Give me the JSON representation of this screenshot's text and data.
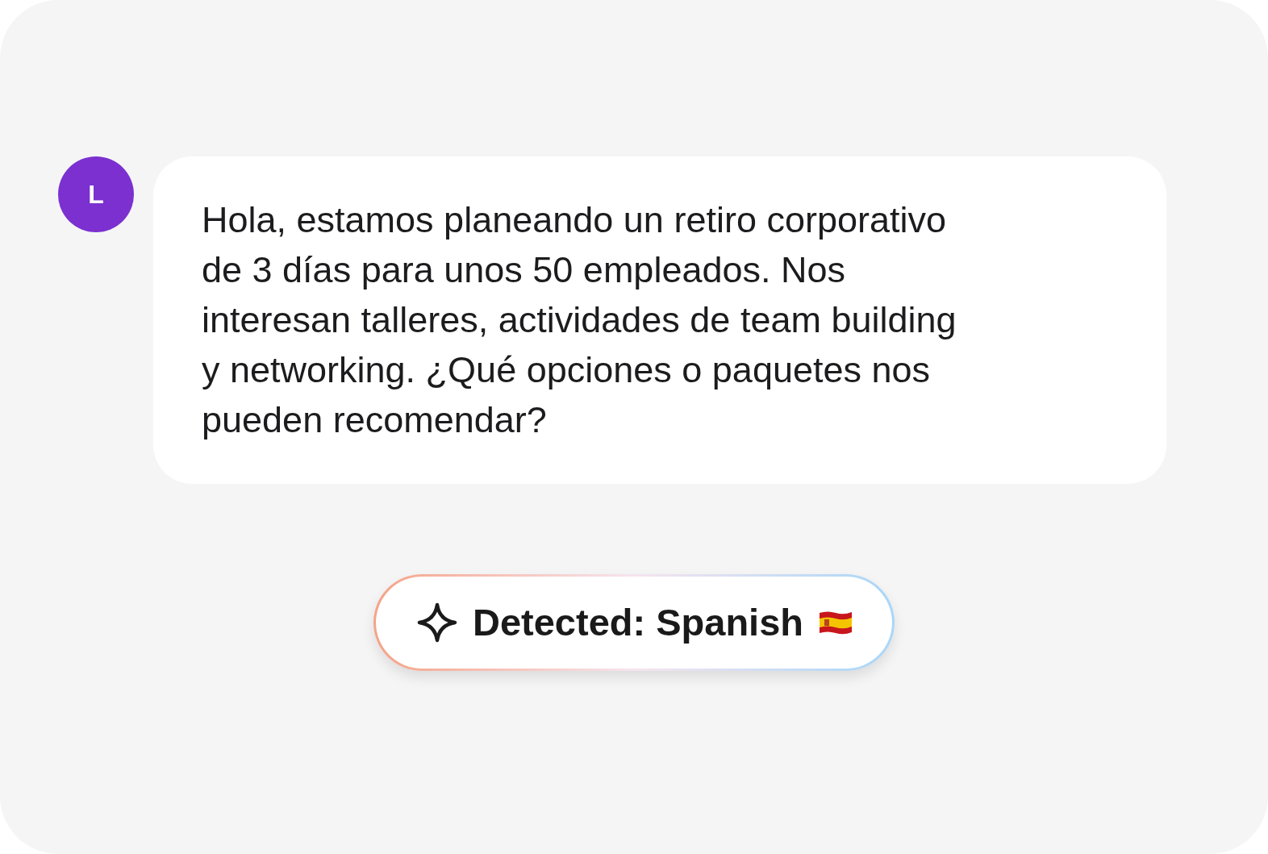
{
  "message": {
    "avatar_initial": "L",
    "text": "Hola, estamos planeando un retiro corporativo de 3 días para unos 50 empleados. Nos interesan talleres, actividades de team building y networking. ¿Qué opciones o paquetes nos pueden recomendar?"
  },
  "detection_badge": {
    "label": "Detected: Spanish"
  }
}
